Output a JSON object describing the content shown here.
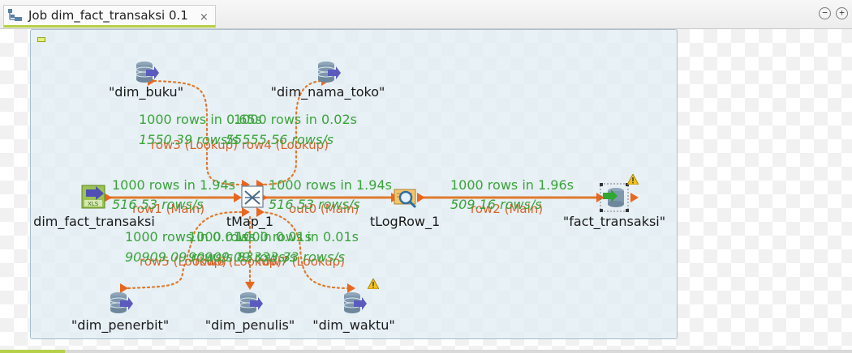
{
  "tab": {
    "title": "Job dim_fact_transaksi 0.1",
    "close": "×"
  },
  "window_buttons": {
    "minimize": "−",
    "maximize": "+"
  },
  "colors": {
    "stat_green": "#3aa33a",
    "flow_orange": "#d8632a",
    "subjob_bg": "#e2edf3",
    "tab_accent": "#b6d04a"
  },
  "components": {
    "dim_buku": {
      "label": "\"dim_buku\"",
      "icon": "database-icon"
    },
    "dim_nama_toko": {
      "label": "\"dim_nama_toko\"",
      "icon": "database-icon"
    },
    "dim_fact_transaksi": {
      "label": "dim_fact_transaksi",
      "icon": "excel-input-icon"
    },
    "tmap": {
      "label": "tMap_1",
      "icon": "tmap-icon"
    },
    "tlogrow": {
      "label": "tLogRow_1",
      "icon": "log-row-icon"
    },
    "fact_transaksi": {
      "label": "\"fact_transaksi\"",
      "icon": "database-output-icon"
    },
    "dim_penerbit": {
      "label": "\"dim_penerbit\"",
      "icon": "database-icon"
    },
    "dim_penulis": {
      "label": "\"dim_penulis\"",
      "icon": "database-icon"
    },
    "dim_waktu": {
      "label": "\"dim_waktu\"",
      "icon": "database-icon"
    }
  },
  "flows": {
    "row3": {
      "name": "row3 (Lookup)",
      "rows": "1000 rows in 0.65s",
      "rate": "1550.39 rows/s"
    },
    "row4": {
      "name": "row4 (Lookup)",
      "rows": "1000 rows in 0.02s",
      "rate": "55555.56 rows/s"
    },
    "row1": {
      "name": "row1 (Main)",
      "rows": "1000 rows in 1.94s",
      "rate": "516.53 rows/s"
    },
    "out0": {
      "name": "out0 (Main)",
      "rows": "1000 rows in 1.94s",
      "rate": "516.53 rows/s"
    },
    "row2": {
      "name": "row2 (Main)",
      "rows": "1000 rows in 1.96s",
      "rate": "509.16 rows/s"
    },
    "row5": {
      "name": "row5 (Lookup)",
      "rows": "1000 rows in 0.01s",
      "rate": "90909.09 rows/s"
    },
    "row6": {
      "name": "row6 (Lookup)",
      "rows": "1000 rows in 0.01s",
      "rate": "90909.09 rows/s"
    },
    "row7": {
      "name": "row7 (Lookup)",
      "rows": "1000 rows in 0.01s",
      "rate": "83333.33 rows/s"
    }
  }
}
